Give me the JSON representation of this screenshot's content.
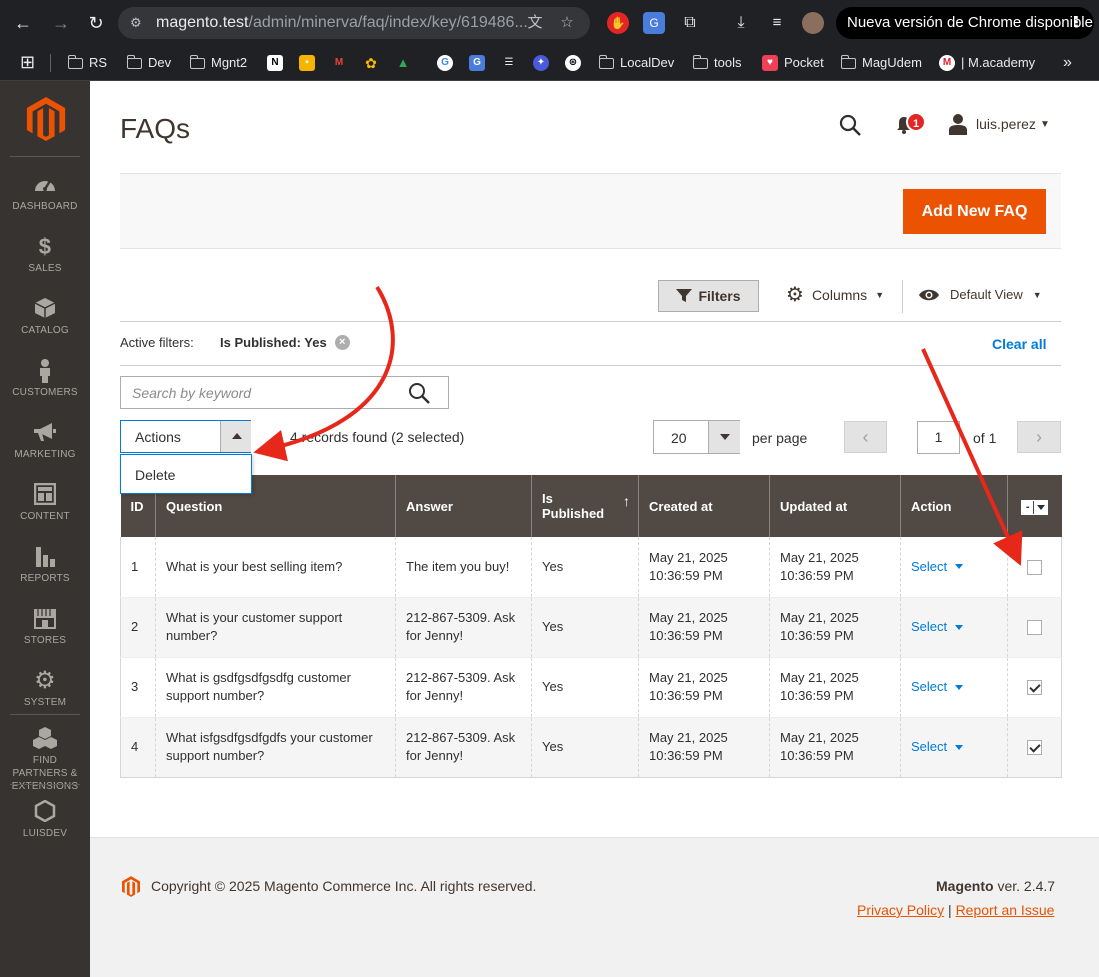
{
  "browser": {
    "url_host": "magento.test",
    "url_path": "/admin/minerva/faq/index/key/619486...",
    "update_label": "Nueva versión de Chrome disponible"
  },
  "bookmarks": [
    {
      "label": "RS",
      "type": "folder"
    },
    {
      "label": "Dev",
      "type": "folder"
    },
    {
      "label": "Mgnt2",
      "type": "folder"
    },
    {
      "label": "",
      "type": "notion-icon"
    },
    {
      "label": "",
      "type": "keep-icon"
    },
    {
      "label": "",
      "type": "gmail-icon"
    },
    {
      "label": "",
      "type": "photos-icon"
    },
    {
      "label": "",
      "type": "drive-icon"
    },
    {
      "label": "",
      "type": "google-icon"
    },
    {
      "label": "",
      "type": "translate-icon"
    },
    {
      "label": "",
      "type": "xi-icon"
    },
    {
      "label": "",
      "type": "star-icon"
    },
    {
      "label": "",
      "type": "openai-icon"
    },
    {
      "label": "LocalDev",
      "type": "folder"
    },
    {
      "label": "tools",
      "type": "folder"
    },
    {
      "label": "Pocket",
      "type": "pocket"
    },
    {
      "label": "MagUdem",
      "type": "folder"
    },
    {
      "label": "| M.academy",
      "type": "m-academy"
    }
  ],
  "sidebar": {
    "items": [
      {
        "label": "DASHBOARD",
        "icon": "dashboard-icon"
      },
      {
        "label": "SALES",
        "icon": "dollar-icon"
      },
      {
        "label": "CATALOG",
        "icon": "box-icon"
      },
      {
        "label": "CUSTOMERS",
        "icon": "person-icon"
      },
      {
        "label": "MARKETING",
        "icon": "megaphone-icon"
      },
      {
        "label": "CONTENT",
        "icon": "layout-icon"
      },
      {
        "label": "REPORTS",
        "icon": "bar-chart-icon"
      },
      {
        "label": "STORES",
        "icon": "store-icon"
      },
      {
        "label": "SYSTEM",
        "icon": "gear-icon"
      },
      {
        "label": "FIND PARTNERS & EXTENSIONS",
        "icon": "cubes-icon"
      },
      {
        "label": "LUISDEV",
        "icon": "hexagon-icon"
      }
    ]
  },
  "header": {
    "title": "FAQs",
    "notifications_count": "1",
    "user_name": "luis.perez"
  },
  "toolbar": {
    "add_label": "Add New FAQ",
    "filters_label": "Filters",
    "columns_label": "Columns",
    "view_label": "Default View",
    "active_filters_label": "Active filters:",
    "active_filter": "Is Published: Yes",
    "clear_all": "Clear all",
    "search_placeholder": "Search by keyword",
    "actions_label": "Actions",
    "actions_option": "Delete",
    "records_text": "4 records found (2 selected)",
    "per_page_value": "20",
    "per_page_label": "per page",
    "page_value": "1",
    "page_of": "of 1"
  },
  "grid": {
    "columns": [
      "ID",
      "Question",
      "Answer",
      "Is Published",
      "Created at",
      "Updated at",
      "Action"
    ],
    "rows": [
      {
        "id": "1",
        "question": "What is your best selling item?",
        "answer": "The item you buy!",
        "published": "Yes",
        "created": "May 21, 2025 10:36:59 PM",
        "updated": "May 21, 2025 10:36:59 PM",
        "action": "Select",
        "checked": false
      },
      {
        "id": "2",
        "question": "What is your customer support number?",
        "answer": "212-867-5309. Ask for Jenny!",
        "published": "Yes",
        "created": "May 21, 2025 10:36:59 PM",
        "updated": "May 21, 2025 10:36:59 PM",
        "action": "Select",
        "checked": false
      },
      {
        "id": "3",
        "question": "What is gsdfgsdfgsdfg customer support number?",
        "answer": "212-867-5309. Ask for Jenny!",
        "published": "Yes",
        "created": "May 21, 2025 10:36:59 PM",
        "updated": "May 21, 2025 10:36:59 PM",
        "action": "Select",
        "checked": true
      },
      {
        "id": "4",
        "question": "What isfgsdfgsdfgdfs your customer support number?",
        "answer": "212-867-5309. Ask for Jenny!",
        "published": "Yes",
        "created": "May 21, 2025 10:36:59 PM",
        "updated": "May 21, 2025 10:36:59 PM",
        "action": "Select",
        "checked": true
      }
    ]
  },
  "footer": {
    "copyright": "Copyright © 2025 Magento Commerce Inc. All rights reserved.",
    "brand": "Magento",
    "version": " ver. 2.4.7",
    "privacy": "Privacy Policy",
    "separator": " | ",
    "report": "Report an Issue"
  },
  "colors": {
    "accent": "#eb5202",
    "sidebar": "#373330",
    "grid_header": "#514943",
    "link": "#007bdb",
    "annotation": "#e8271b"
  }
}
